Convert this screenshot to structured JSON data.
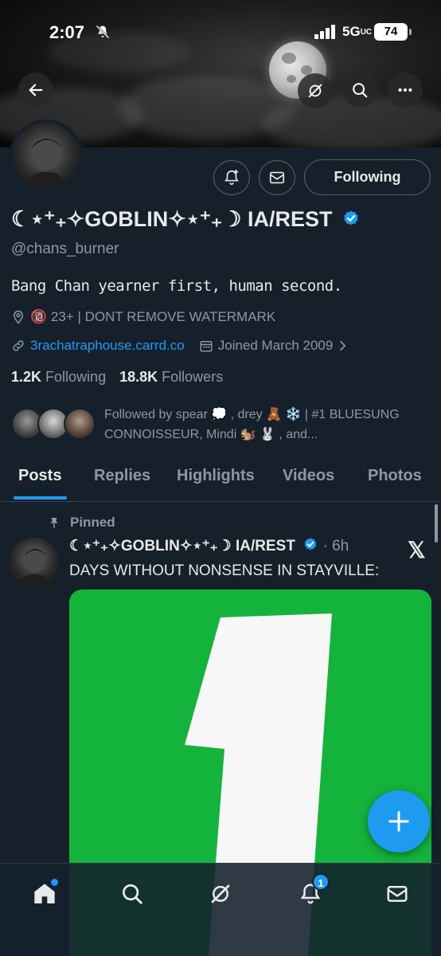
{
  "status_bar": {
    "time": "2:07",
    "network": "5G",
    "network_sub": "UC",
    "battery": "74"
  },
  "header": {
    "back_icon": "back-arrow-icon",
    "grok_icon": "grok-icon",
    "search_icon": "search-icon",
    "more_icon": "more-icon"
  },
  "profile": {
    "name": "☾⋆⁺₊✧GOBLIN✧⋆⁺₊☽ IA/REST",
    "handle": "@chans_burner",
    "bio": "Bang Chan yearner first, human second.",
    "location": "🔞 23+ | DONT REMOVE WATERMARK",
    "website": "3rachatraphouse.carrd.co",
    "joined": "Joined March 2009",
    "following_count": "1.2K",
    "following_label": "Following",
    "followers_count": "18.8K",
    "followers_label": "Followers",
    "followed_by": "Followed by spear 💭 , drey 🧸 ❄️ | #1 BLUESUNG CONNOISSEUR, Mindi 🐿️ 🐰 , and..."
  },
  "actions": {
    "notify_icon": "bell-plus-icon",
    "message_icon": "envelope-icon",
    "follow_label": "Following"
  },
  "tabs": [
    "Posts",
    "Replies",
    "Highlights",
    "Videos",
    "Photos"
  ],
  "active_tab": "Posts",
  "post": {
    "pinned_label": "Pinned",
    "author": "☾⋆⁺₊✧GOBLIN✧⋆⁺₊☽ IA/REST",
    "time": "· 6h",
    "text": "DAYS WITHOUT NONSENSE IN STAYVILLE:",
    "image_number": "1",
    "image_color": "#13b33c"
  },
  "colors": {
    "background": "#15202b",
    "accent": "#1d9bf0",
    "muted": "#8b98a5"
  },
  "bottom_nav": {
    "items": [
      "home-icon",
      "search-icon",
      "grok-icon",
      "notifications-icon",
      "messages-icon"
    ],
    "notification_badge": "1"
  }
}
